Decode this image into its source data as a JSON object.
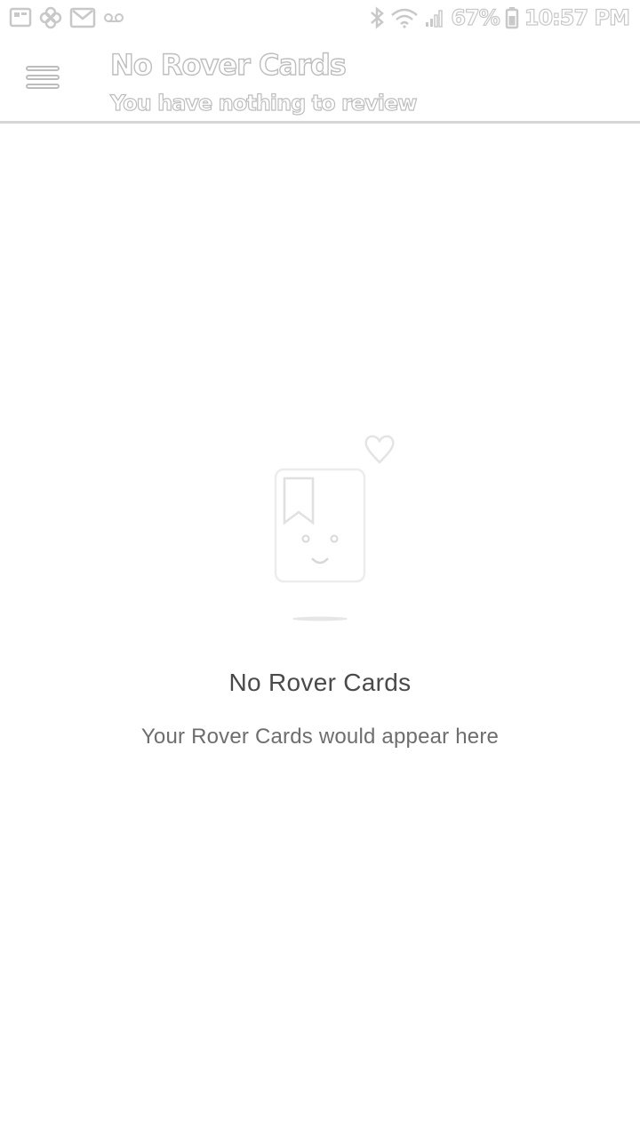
{
  "status_bar": {
    "left_icons": [
      "image-notification-icon",
      "pinwheel-notification-icon",
      "gmail-icon",
      "voicemail-icon"
    ],
    "right_icons": [
      "bluetooth-icon",
      "wifi-icon",
      "signal-icon",
      "battery-icon"
    ],
    "battery": "67%",
    "time": "10:57 PM"
  },
  "app_bar": {
    "menu_icon": "hamburger-menu-icon",
    "title": "No Rover Cards",
    "subtitle": "You have nothing to review"
  },
  "empty_state": {
    "illustration_icon": "smiling-card-with-heart-icon",
    "title": "No Rover Cards",
    "message": "Your Rover Cards would appear here"
  },
  "colors": {
    "background": "#ffffff",
    "icon_outline": "#c8c8c8",
    "title_text": "#4a4a4a",
    "message_text": "#6e6e6e",
    "divider": "#d6d6d6"
  }
}
